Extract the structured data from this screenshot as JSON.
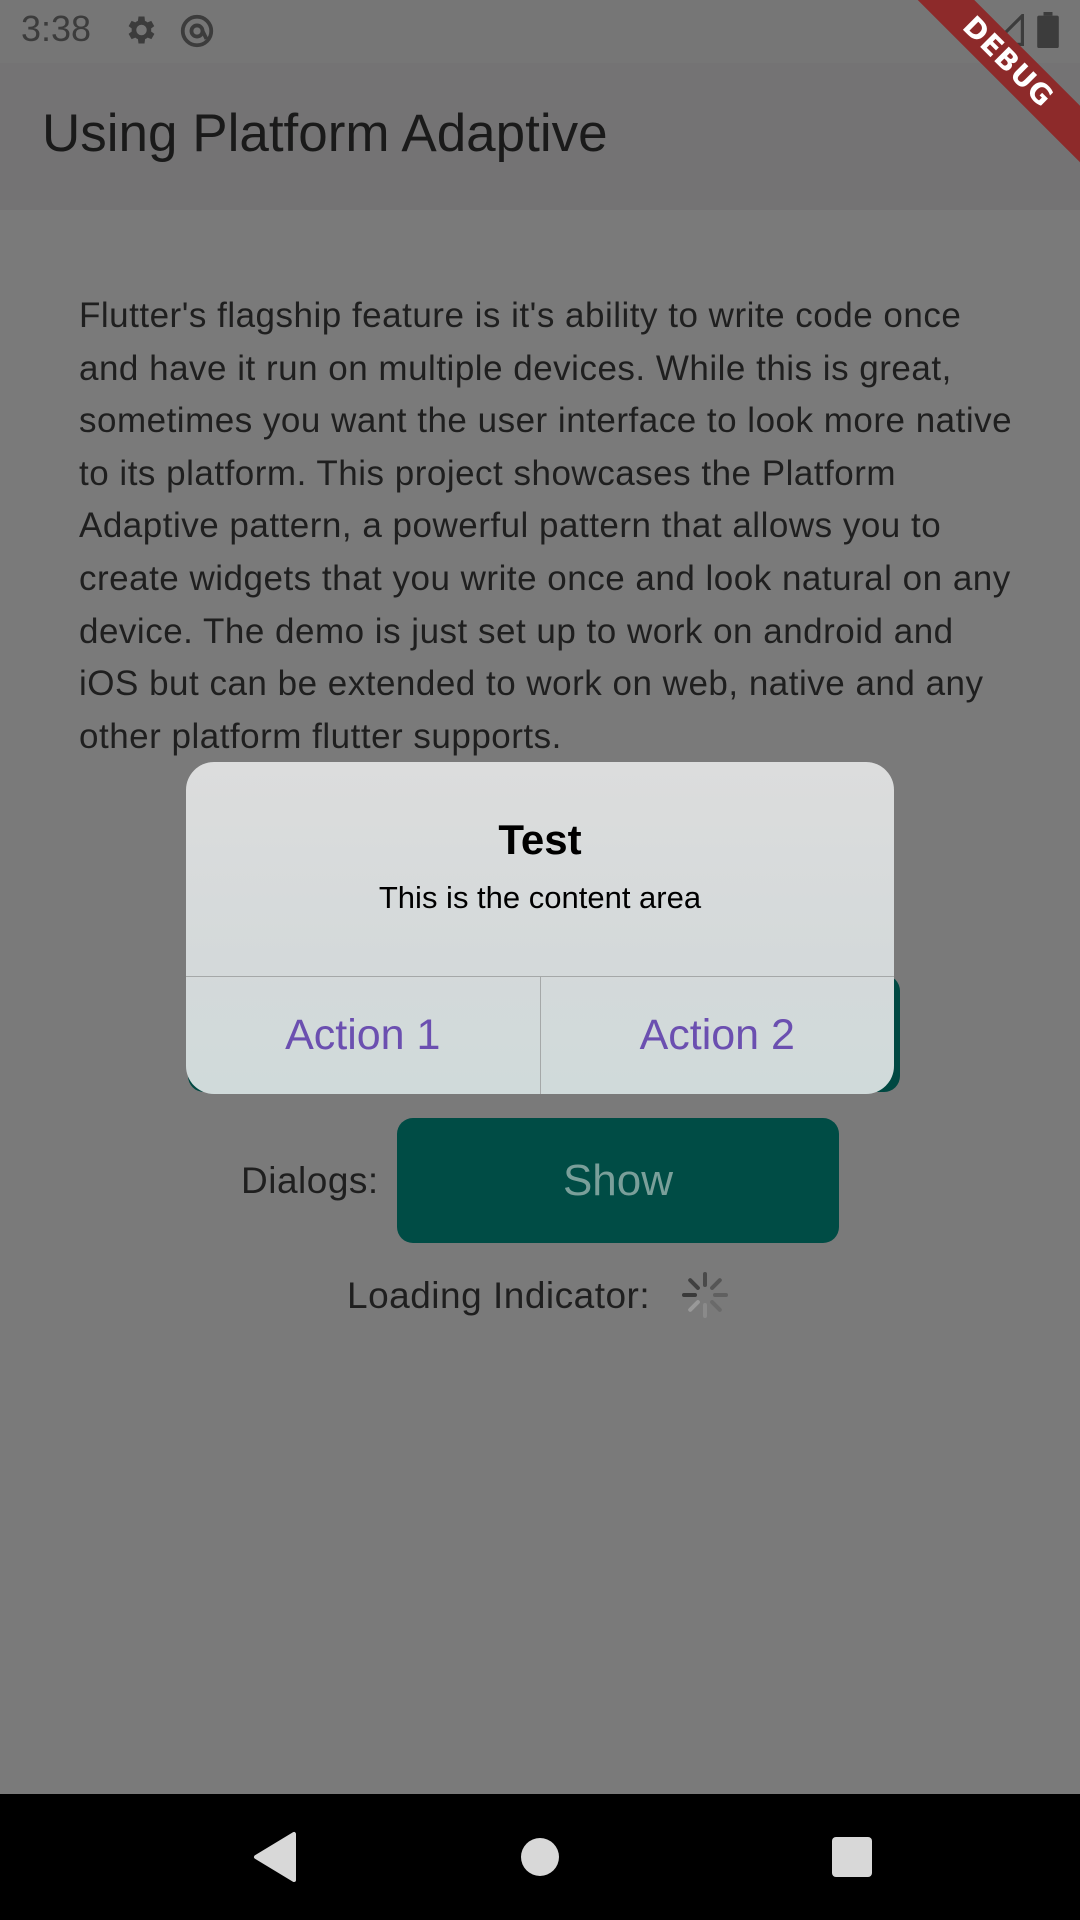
{
  "status_bar": {
    "time": "3:38",
    "icons_left": [
      "gear-icon",
      "at-icon"
    ],
    "icons_right": [
      "wifi-icon",
      "signal-icon",
      "battery-icon"
    ]
  },
  "debug_banner": "DEBUG",
  "app_bar": {
    "title": "Using Platform Adaptive"
  },
  "main": {
    "description": "Flutter's flagship feature is it's ability to write code once and have it run on multiple devices. While this is great, sometimes you want the user interface to look more native to its platform. This project showcases the Platform Adaptive pattern, a powerful pattern that allows you to create widgets that you write once and look natural on any device. The demo is just set up to work on android and iOS but can be extended to work on web, native and any other platform flutter supports.",
    "dialogs_label": "Dialogs:",
    "show_button": "Show",
    "loading_label": "Loading Indicator:"
  },
  "dialog": {
    "title": "Test",
    "content": "This is the content area",
    "actions": [
      "Action 1",
      "Action 2"
    ]
  },
  "colors": {
    "button": "#004c45",
    "action_text": "#6b4fb0",
    "debug": "#8d2a2a"
  }
}
